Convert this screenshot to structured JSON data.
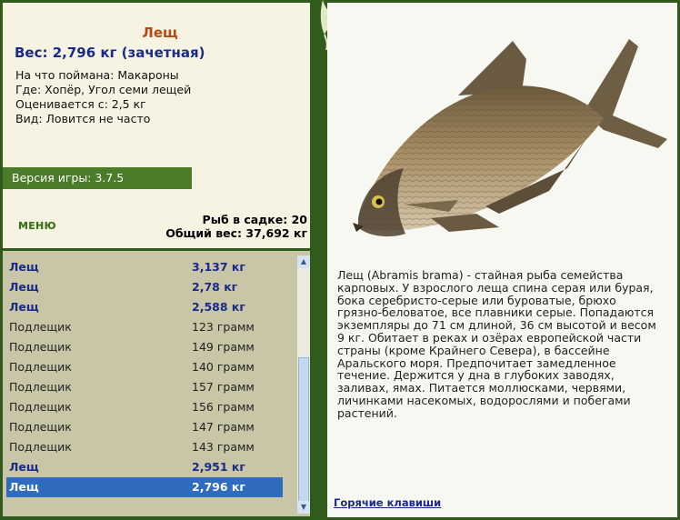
{
  "fish": {
    "name": "Лещ",
    "weight_line": "Вес: 2,796 кг (зачетная)",
    "bait": "На что поймана: Макароны",
    "location": "Где: Хопёр, Угол семи лещей",
    "rated_from": "Оценивается с: 2,5 кг",
    "kind": "Вид: Ловится не часто"
  },
  "version": "Версия игры: 3.7.5",
  "menu_label": "МЕНЮ",
  "stats": {
    "fish_count": "Рыб в садке: 20",
    "total_weight": "Общий вес: 37,692 кг"
  },
  "catch_list": [
    {
      "name": "Лещ",
      "weight": "3,137 кг",
      "type": "big"
    },
    {
      "name": "Лещ",
      "weight": "2,78 кг",
      "type": "big"
    },
    {
      "name": "Лещ",
      "weight": "2,588 кг",
      "type": "big"
    },
    {
      "name": "Подлещик",
      "weight": "123 грамм",
      "type": "small"
    },
    {
      "name": "Подлещик",
      "weight": "149 грамм",
      "type": "small"
    },
    {
      "name": "Подлещик",
      "weight": "140 грамм",
      "type": "small"
    },
    {
      "name": "Подлещик",
      "weight": "157 грамм",
      "type": "small"
    },
    {
      "name": "Подлещик",
      "weight": "156 грамм",
      "type": "small"
    },
    {
      "name": "Подлещик",
      "weight": "147 грамм",
      "type": "small"
    },
    {
      "name": "Подлещик",
      "weight": "143 грамм",
      "type": "small"
    },
    {
      "name": "Лещ",
      "weight": "2,951 кг",
      "type": "big"
    },
    {
      "name": "Лещ",
      "weight": "2,796 кг",
      "type": "selected"
    }
  ],
  "description": "Лещ (Abramis brama) - стайная рыба семейства карповых. У взрослого леща спина серая или бурая, бока серебристо-серые или буроватые, брюхо грязно-беловатое, все плавники серые. Попадаются экземпляры до 71 см длиной, 36 см высотой и весом 9 кг. Обитает в реках и озёрах европейской части страны (кроме Крайнего Севера), в бассейне Аральского моря. Предпочитает замедленное течение. Держится у дна в глубоких заводях, заливах, ямах. Питается моллюсками, червями, личинками насекомых, водорослями и побегами растений.",
  "hotkeys_label": "Горячие клавиши",
  "icons": {
    "scroll_up": "scroll-up-icon",
    "scroll_down": "scroll-down-icon"
  },
  "colors": {
    "accent_green": "#4c7b2a",
    "title_orange": "#b44a10",
    "big_fish_blue": "#1a2a88",
    "selection": "#2f6cc0"
  }
}
